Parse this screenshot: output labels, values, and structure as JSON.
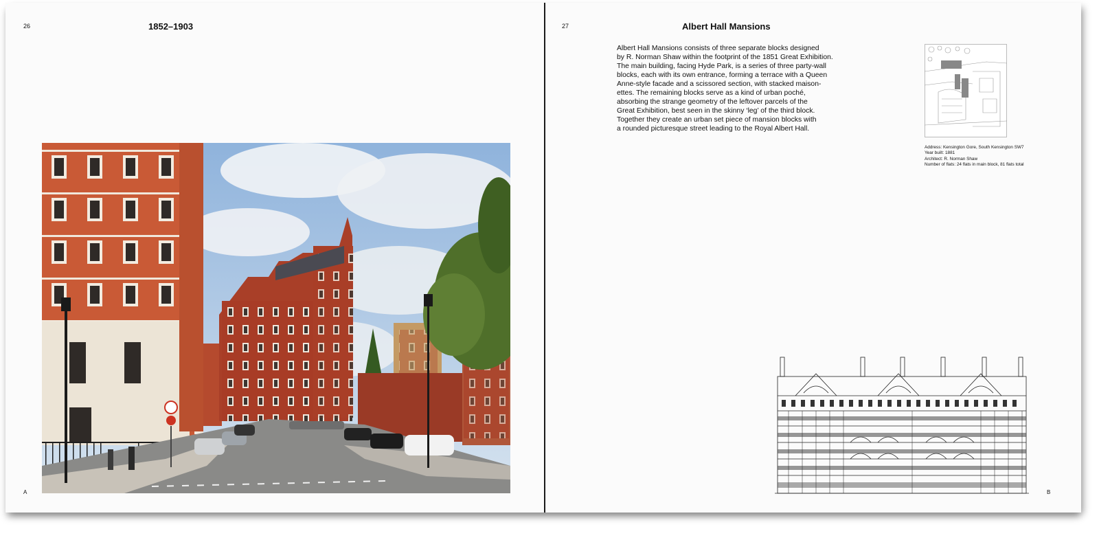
{
  "left_page": {
    "page_number": "26",
    "running_head": "1852–1903",
    "photo_label": "A",
    "photo_icon": "street-photo-albert-hall-mansions"
  },
  "right_page": {
    "page_number": "27",
    "title": "Albert Hall Mansions",
    "body": "Albert Hall Mansions consists of three separate blocks designed by R. Norman Shaw within the footprint of the 1851 Great Exhibition. The main building, facing Hyde Park, is a series of three party-wall blocks, each with its own entrance, forming a terrace with a Queen Anne-style facade and a scissored section, with stacked maisonettes. The remaining blocks serve as a kind of urban poché, absorbing the strange geometry of the leftover parcels of the Great Exhibition, best seen in the skinny ‘leg’ of the third block. Together they create an urban set piece of mansion blocks with a rounded picturesque street leading to the Royal Albert Hall.",
    "body_lines": [
      "Albert Hall Mansions consists of three separate blocks designed",
      "by R. Norman Shaw within the footprint of the 1851 Great Exhibition.",
      "The main building, facing Hyde Park, is a series of three party-wall",
      "blocks, each with its own entrance, forming a terrace with a Queen",
      "Anne-style facade and a scissored section, with stacked maison-",
      "ettes. The remaining blocks serve as a kind of urban poché,",
      "absorbing the strange geometry of the leftover parcels of the",
      "Great Exhibition, best seen in the skinny ‘leg’ of the third block.",
      "Together they create an urban set piece of mansion blocks with",
      "a rounded picturesque street leading to the Royal Albert Hall."
    ],
    "details": [
      "Address: Kensington Gore, South Kensington SW7",
      "Year built: 1881",
      "Architect: R. Norman Shaw",
      "Number of flats: 24 flats in main block, 81 flats total"
    ],
    "elevation_label": "B",
    "siteplan_icon": "site-plan-drawing",
    "elevation_icon": "facade-elevation-drawing"
  },
  "colors": {
    "brick": "#b8462c",
    "brick_dark": "#8e3322",
    "sky": "#a9c6e4",
    "road": "#8a8a88",
    "tree": "#4f6f2a",
    "stone": "#ece4d6",
    "gutter": "#1a1a1a"
  }
}
